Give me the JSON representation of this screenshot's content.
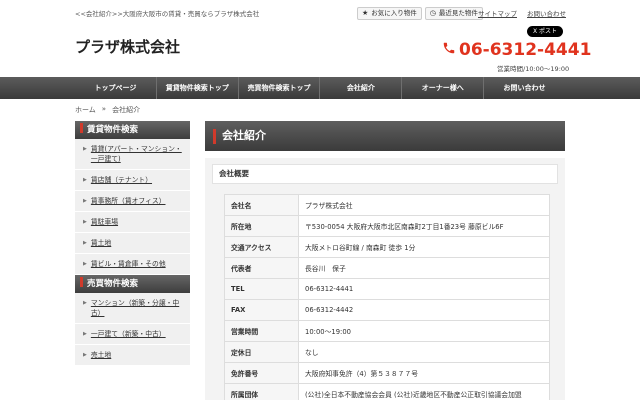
{
  "header": {
    "topline": "<<会社紹介>>大阪府大阪市の賃貸・売買ならプラザ株式会社",
    "favorites_label": "お気に入り物件",
    "recent_label": "最近見た物件",
    "sitemap_label": "サイトマップ",
    "contact_link_label": "お問い合わせ",
    "company_name": "プラザ株式会社",
    "xpost_label": "X ポスト",
    "phone": "06-6312-4441",
    "hours": "営業時間/10:00～19:00"
  },
  "nav": [
    {
      "label": "トップページ"
    },
    {
      "label": "賃貸物件検索トップ"
    },
    {
      "label": "売買物件検索トップ"
    },
    {
      "label": "会社紹介"
    },
    {
      "label": "オーナー様へ"
    },
    {
      "label": "お問い合わせ"
    }
  ],
  "breadcrumb": {
    "home": "ホーム",
    "sep": "»",
    "current": "会社紹介"
  },
  "sidebar": {
    "rent_title": "賃貸物件検索",
    "rent_items": [
      {
        "label": "賃貸(アパート・マンション・一戸建て)"
      },
      {
        "label": "賃店舗（テナント）"
      },
      {
        "label": "賃事務所（賃オフィス）"
      },
      {
        "label": "賃駐車場"
      },
      {
        "label": "賃土地"
      },
      {
        "label": "賃ビル・賃倉庫・その他"
      }
    ],
    "sale_title": "売買物件検索",
    "sale_items": [
      {
        "label": "マンション（新築・分譲・中古）"
      },
      {
        "label": "一戸建て（新築・中古）"
      },
      {
        "label": "売土地"
      }
    ]
  },
  "main": {
    "title": "会社紹介",
    "section_title": "会社概要",
    "rows": [
      {
        "key": "会社名",
        "value": "プラザ株式会社"
      },
      {
        "key": "所在地",
        "value": "〒530-0054 大阪府大阪市北区南森町2丁目1番23号 藤原ビル6F"
      },
      {
        "key": "交通アクセス",
        "value": "大阪メトロ谷町線 / 南森町 徒歩 1分"
      },
      {
        "key": "代表者",
        "value": "長谷川　保子"
      },
      {
        "key": "TEL",
        "value": "06-6312-4441"
      },
      {
        "key": "FAX",
        "value": "06-6312-4442"
      },
      {
        "key": "営業時間",
        "value": "10:00～19:00"
      },
      {
        "key": "定休日",
        "value": "なし"
      },
      {
        "key": "免許番号",
        "value": "大阪府知事免許（4）第５３８７７号"
      },
      {
        "key": "所属団体",
        "value": "(公社)全日本不動産協会会員 (公社)近畿地区不動産公正取引協議会加盟"
      }
    ]
  },
  "colors": {
    "accent": "#d03a2b",
    "phone": "#e0331e",
    "nav_bg": "#444444"
  },
  "icons": {
    "favorites": "star-icon",
    "recent": "clock-icon",
    "phone": "phone-icon"
  }
}
